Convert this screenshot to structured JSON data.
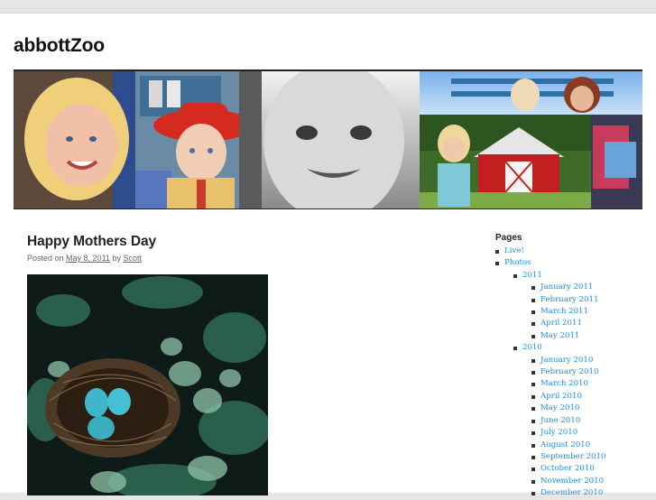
{
  "site": {
    "title": "abbottZoo"
  },
  "header": {
    "banner_icon": "family-photo-collage"
  },
  "post": {
    "title": "Happy Mothers Day",
    "meta": {
      "prefix": "Posted on",
      "date": "May 8, 2011",
      "by": "by",
      "author": "Scott"
    },
    "image_icon": "robin-egg-nest-photo"
  },
  "sidebar": {
    "widget_title": "Pages",
    "items": [
      {
        "label": "Live!"
      },
      {
        "label": "Photos",
        "children": [
          {
            "label": "2011",
            "children": [
              {
                "label": "January 2011"
              },
              {
                "label": "February 2011"
              },
              {
                "label": "March 2011"
              },
              {
                "label": "April 2011"
              },
              {
                "label": "May 2011"
              }
            ]
          },
          {
            "label": "2010",
            "children": [
              {
                "label": "January 2010"
              },
              {
                "label": "February 2010"
              },
              {
                "label": "March 2010"
              },
              {
                "label": "April 2010"
              },
              {
                "label": "May 2010"
              },
              {
                "label": "June 2010"
              },
              {
                "label": "July 2010"
              },
              {
                "label": "August 2010"
              },
              {
                "label": "September 2010"
              },
              {
                "label": "October 2010"
              },
              {
                "label": "November 2010"
              },
              {
                "label": "December 2010"
              }
            ]
          }
        ]
      }
    ]
  },
  "colors": {
    "link": "#1b8be0",
    "text": "#222222",
    "meta": "#666666",
    "background": "#e6e6e6"
  }
}
